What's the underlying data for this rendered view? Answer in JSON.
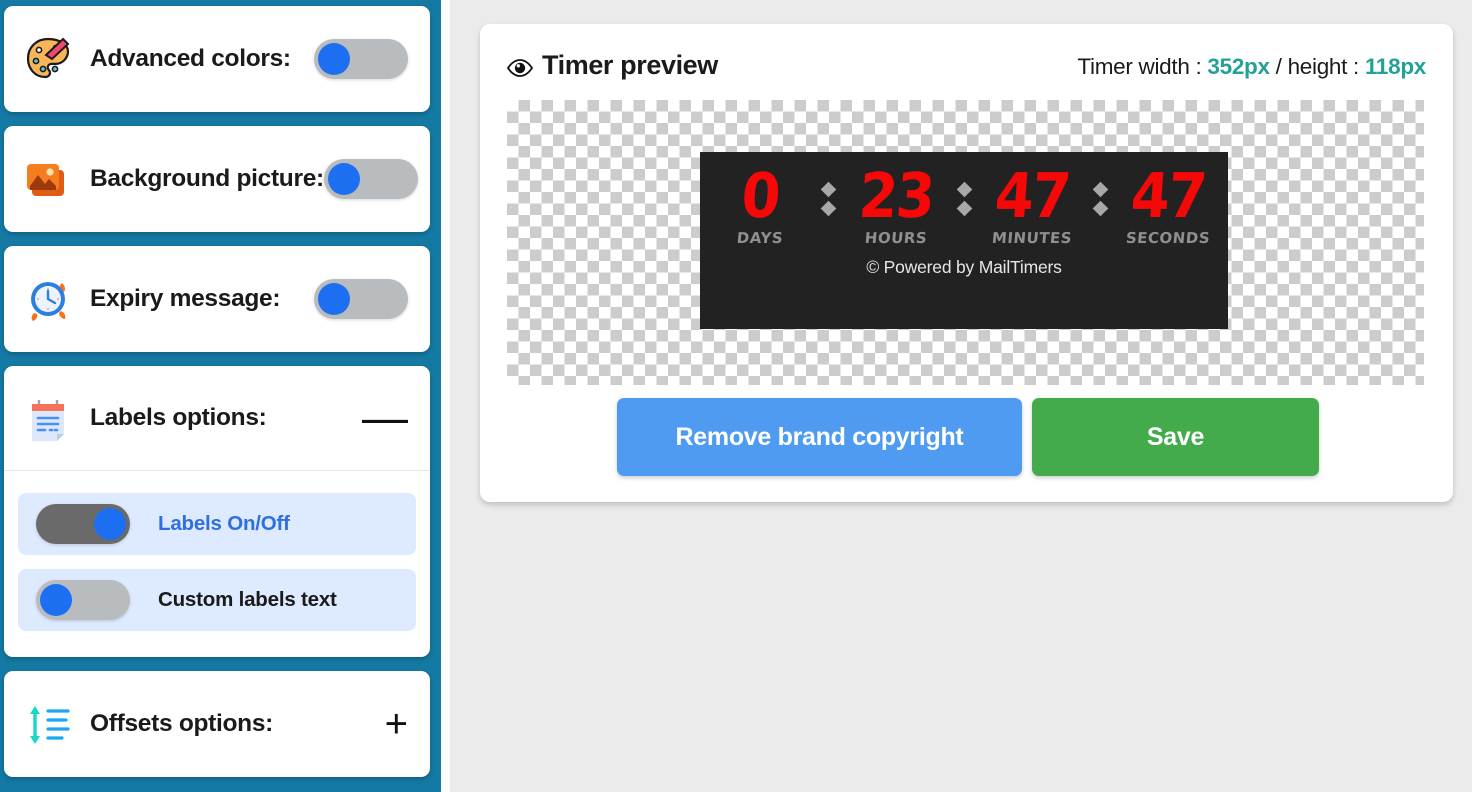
{
  "theme": {
    "sidebar_bg": "#1479a3",
    "page_bg": "#ebebeb",
    "accent_teal": "#23a197",
    "toggle_blue": "#1d6ff2",
    "btn_blue": "#4f9bf2",
    "btn_green": "#43ab4b",
    "timer_digit_red": "#f50808",
    "timer_bg": "#222222"
  },
  "sidebar": {
    "panels": [
      {
        "id": "advanced-colors",
        "icon": "palette-icon",
        "title": "Advanced colors:",
        "control": "toggle",
        "toggle_state": "off"
      },
      {
        "id": "background-picture",
        "icon": "images-icon",
        "title": "Background picture:",
        "control": "toggle",
        "toggle_state": "off"
      },
      {
        "id": "expiry-message",
        "icon": "alarm-clock-icon",
        "title": "Expiry message:",
        "control": "toggle",
        "toggle_state": "off"
      },
      {
        "id": "labels-options",
        "icon": "calendar-note-icon",
        "title": "Labels options:",
        "control": "expander",
        "expander_glyph": "—",
        "expanded": true,
        "rows": [
          {
            "id": "labels-on-off",
            "label": "Labels On/Off",
            "toggle_state": "on",
            "label_accent": true
          },
          {
            "id": "custom-labels-text",
            "label": "Custom labels text",
            "toggle_state": "off",
            "label_accent": false
          }
        ]
      },
      {
        "id": "offsets-options",
        "icon": "offsets-icon",
        "title": "Offsets options:",
        "control": "expander",
        "expander_glyph": "+",
        "expanded": false
      }
    ]
  },
  "preview": {
    "eye_icon": "eye-icon",
    "title": "Timer preview",
    "dims_prefix": "Timer width : ",
    "width_value": "352px",
    "dims_middle": " / height : ",
    "height_value": "118px",
    "timer": {
      "units": [
        {
          "value": "0",
          "label": "DAYS"
        },
        {
          "value": "23",
          "label": "HOURS"
        },
        {
          "value": "47",
          "label": "MINUTES"
        },
        {
          "value": "47",
          "label": "SECONDS"
        }
      ],
      "separator": ":",
      "footer": "© Powered by MailTimers"
    },
    "buttons": {
      "remove_copyright": "Remove brand copyright",
      "save": "Save"
    }
  }
}
